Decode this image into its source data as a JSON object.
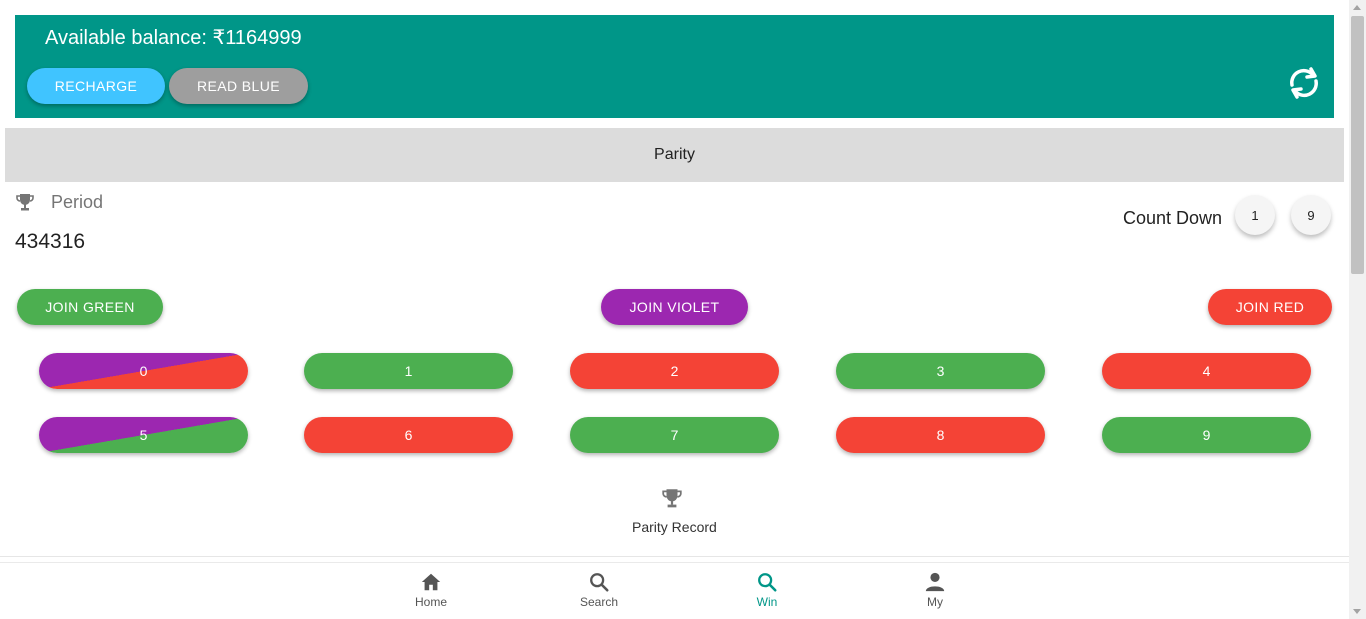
{
  "header": {
    "balance_text": "Available balance: ₹1164999",
    "recharge_label": "RECHARGE",
    "readblue_label": "READ BLUE"
  },
  "tabs": {
    "active_label": "Parity"
  },
  "period": {
    "label": "Period",
    "value": "434316"
  },
  "countdown": {
    "label": "Count Down",
    "digits": [
      "1",
      "9"
    ]
  },
  "join": {
    "green_label": "JOIN GREEN",
    "violet_label": "JOIN VIOLET",
    "red_label": "JOIN RED"
  },
  "numbers": [
    {
      "label": "0",
      "color": "violet-red"
    },
    {
      "label": "1",
      "color": "green"
    },
    {
      "label": "2",
      "color": "red"
    },
    {
      "label": "3",
      "color": "green"
    },
    {
      "label": "4",
      "color": "red"
    },
    {
      "label": "5",
      "color": "violet-green"
    },
    {
      "label": "6",
      "color": "red"
    },
    {
      "label": "7",
      "color": "green"
    },
    {
      "label": "8",
      "color": "red"
    },
    {
      "label": "9",
      "color": "green"
    }
  ],
  "record": {
    "label": "Parity Record"
  },
  "bottom_nav": [
    {
      "label": "Home",
      "icon": "home-icon"
    },
    {
      "label": "Search",
      "icon": "search-icon"
    },
    {
      "label": "Win",
      "icon": "search-icon",
      "active": true
    },
    {
      "label": "My",
      "icon": "person-icon"
    }
  ],
  "colors": {
    "teal": "#009688",
    "green": "#4caf50",
    "red": "#f44336",
    "violet": "#9c27b0",
    "light_blue": "#40c4ff",
    "grey": "#9e9e9e"
  }
}
